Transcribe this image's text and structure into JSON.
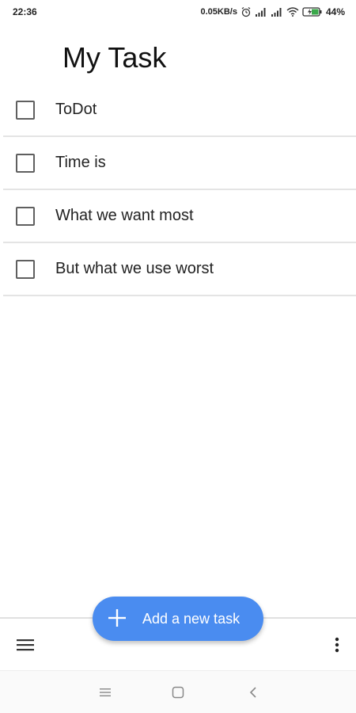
{
  "status_bar": {
    "time": "22:36",
    "network_speed": "0.05KB/s",
    "battery": "44%",
    "icons": [
      "alarm-icon",
      "signal-icon",
      "signal-icon",
      "wifi-icon",
      "battery-icon"
    ]
  },
  "header": {
    "title": "My Task"
  },
  "tasks": [
    {
      "label": "ToDot",
      "checked": false
    },
    {
      "label": "Time is",
      "checked": false
    },
    {
      "label": "What we want most",
      "checked": false
    },
    {
      "label": "But what we use worst",
      "checked": false
    }
  ],
  "bottom_bar": {
    "menu_icon": "hamburger-menu-icon",
    "more_icon": "more-vert-icon",
    "fab_label": "Add a new task",
    "fab_icon": "plus-icon",
    "fab_color": "#4a8cf0"
  },
  "nav_bar": {
    "icons": [
      "recents-icon",
      "home-icon",
      "back-icon"
    ]
  }
}
